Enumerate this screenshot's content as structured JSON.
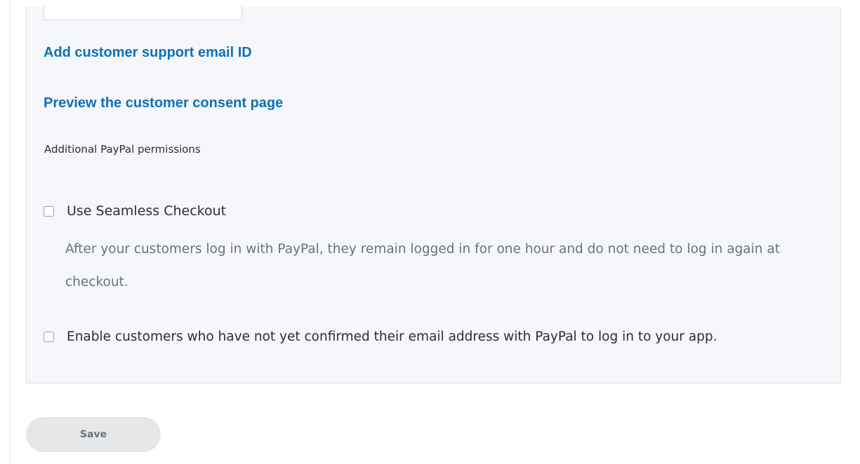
{
  "links": {
    "add_support_email": "Add customer support email ID",
    "preview_consent": "Preview the customer consent page"
  },
  "permissions": {
    "title": "Additional PayPal permissions",
    "options": [
      {
        "label": "Use Seamless Checkout",
        "description": "After your customers log in with PayPal, they remain logged in for one hour and do not need to log in again at checkout.",
        "checked": false
      },
      {
        "label": "Enable customers who have not yet confirmed their email address with PayPal to log in to your app.",
        "checked": false
      }
    ]
  },
  "actions": {
    "save_label": "Save"
  },
  "colors": {
    "link": "#0f71b8",
    "panel_bg": "#f5f7fa",
    "button_bg": "#e6e7e8"
  }
}
